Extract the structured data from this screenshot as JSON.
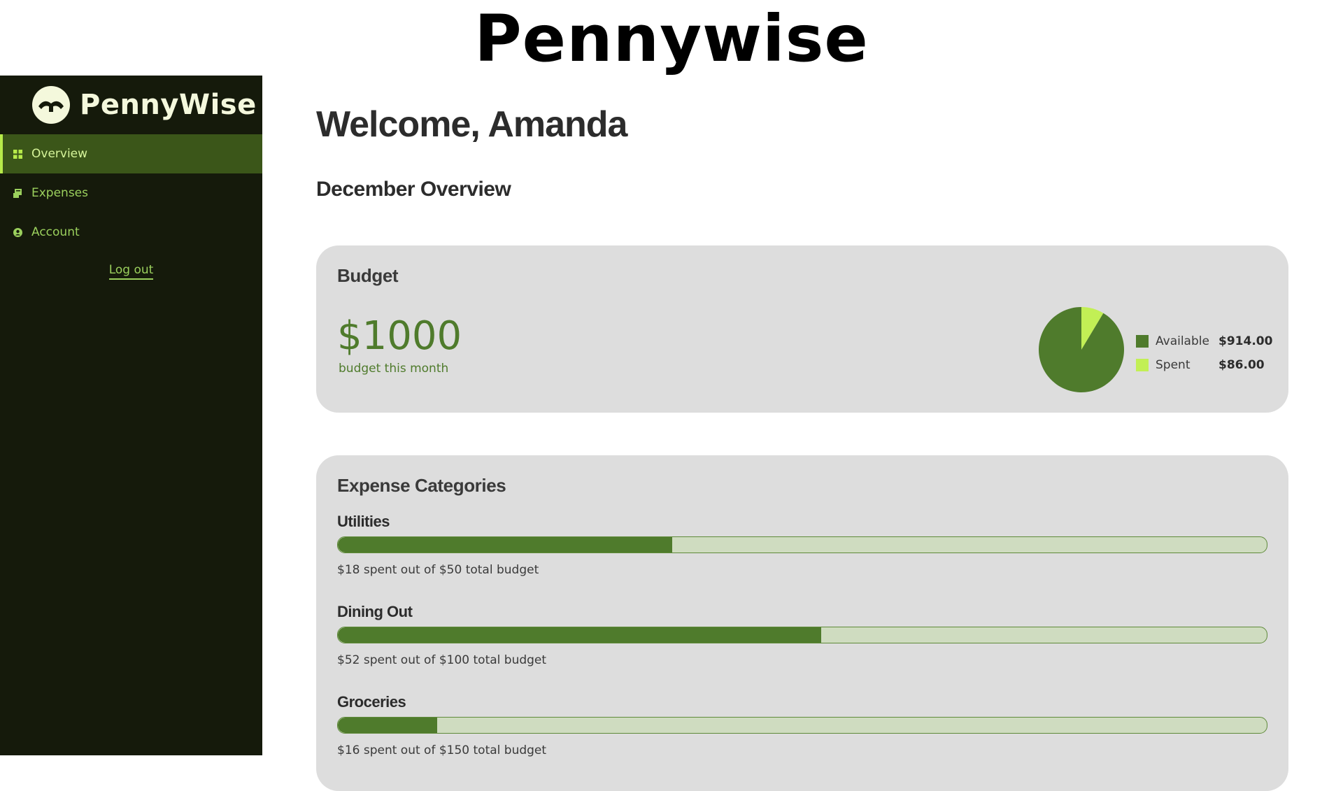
{
  "page_title": "Pennywise",
  "sidebar": {
    "brand": "PennyWise",
    "items": [
      {
        "label": "Overview",
        "icon": "grid-icon",
        "active": true
      },
      {
        "label": "Expenses",
        "icon": "receipt-icon",
        "active": false
      },
      {
        "label": "Account",
        "icon": "user-circle-icon",
        "active": false
      }
    ],
    "logout_label": "Log out"
  },
  "main": {
    "welcome": "Welcome, Amanda",
    "overview_title": "December Overview"
  },
  "budget": {
    "title": "Budget",
    "amount": "$1000",
    "caption": "budget this month",
    "legend": [
      {
        "label": "Available",
        "value": "$914.00",
        "color": "#4f7b2c"
      },
      {
        "label": "Spent",
        "value": "$86.00",
        "color": "#c2ef55"
      }
    ]
  },
  "chart_data": {
    "type": "pie",
    "categories": [
      "Available",
      "Spent"
    ],
    "values": [
      914,
      86
    ],
    "colors": [
      "#4f7b2c",
      "#c2ef55"
    ]
  },
  "expenses": {
    "title": "Expense Categories",
    "categories": [
      {
        "name": "Utilities",
        "spent": 18,
        "total": 50,
        "caption": "$18 spent out of $50 total budget"
      },
      {
        "name": "Dining Out",
        "spent": 52,
        "total": 100,
        "caption": "$52 spent out of $100 total budget"
      },
      {
        "name": "Groceries",
        "spent": 16,
        "total": 150,
        "caption": "$16 spent out of $150 total budget"
      }
    ]
  },
  "colors": {
    "sidebar_bg": "#151a0b",
    "accent": "#4f7b2c",
    "accent_light": "#c2ef55",
    "card_bg": "#dddddd"
  }
}
